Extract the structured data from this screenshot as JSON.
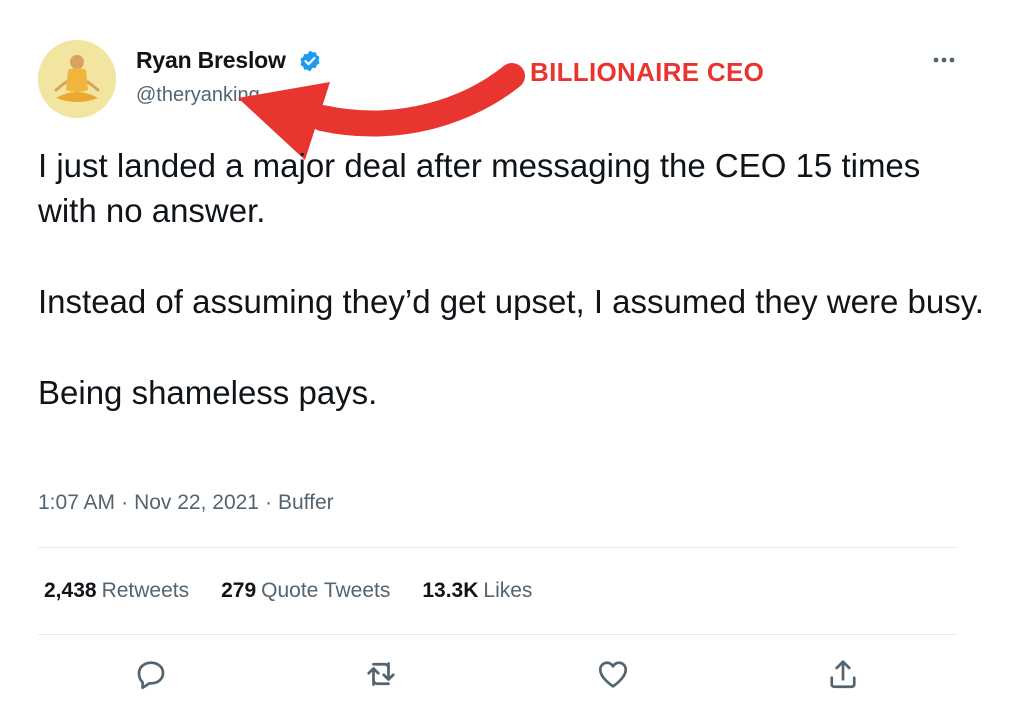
{
  "author": {
    "display_name": "Ryan Breslow",
    "handle": "@theryanking",
    "verified_color": "#1d9bf0"
  },
  "annotation": {
    "label": "BILLIONAIRE CEO",
    "color": "#e8352f"
  },
  "tweet": {
    "paragraphs": [
      "I just landed a major deal after messaging the CEO 15 times with no answer.",
      "Instead of assuming they’d get upset, I assumed they were busy.",
      "Being shameless pays."
    ],
    "time": "1:07 AM",
    "date": "Nov 22, 2021",
    "source": "Buffer",
    "separator": "·"
  },
  "stats": {
    "retweets_count": "2,438",
    "retweets_label": "Retweets",
    "quotes_count": "279",
    "quotes_label": "Quote Tweets",
    "likes_count": "13.3K",
    "likes_label": "Likes"
  },
  "icons": {
    "more": "more-horizontal-icon",
    "reply": "reply-icon",
    "retweet": "retweet-icon",
    "like": "heart-icon",
    "share": "share-icon"
  }
}
